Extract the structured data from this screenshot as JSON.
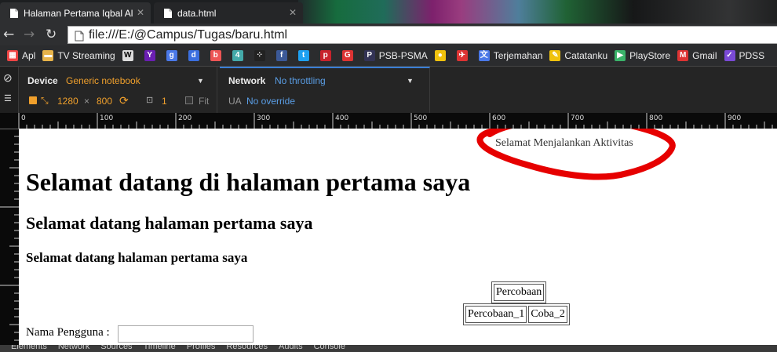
{
  "browser": {
    "tabs": [
      {
        "title": "Halaman Pertama Iqbal Al",
        "active": true
      },
      {
        "title": "data.html",
        "active": false
      }
    ],
    "address": "file:///E:/@Campus/Tugas/baru.html"
  },
  "bookmarks": [
    {
      "label": "Apl",
      "icon": "apps-grid-icon",
      "color": "#e44"
    },
    {
      "label": "TV Streaming",
      "icon": "folder-icon",
      "color": "#e8b44a"
    },
    {
      "label": "",
      "icon": "wikipedia-icon",
      "color": "#ddd"
    },
    {
      "label": "",
      "icon": "yahoo-icon",
      "color": "#6a1fb2"
    },
    {
      "label": "",
      "icon": "google-icon",
      "color": "#4a78e8"
    },
    {
      "label": "",
      "icon": "dailymotion-icon",
      "color": "#3b6fe0"
    },
    {
      "label": "",
      "icon": "blogger-icon",
      "color": "#e55"
    },
    {
      "label": "",
      "icon": "four-icon",
      "color": "#4aa"
    },
    {
      "label": "",
      "icon": "blackberry-icon",
      "color": "#222"
    },
    {
      "label": "",
      "icon": "facebook-icon",
      "color": "#3b5998"
    },
    {
      "label": "",
      "icon": "twitter-icon",
      "color": "#1da1f2"
    },
    {
      "label": "",
      "icon": "pinterest-icon",
      "color": "#c8232c"
    },
    {
      "label": "",
      "icon": "g-red-icon",
      "color": "#d33"
    },
    {
      "label": "PSB-PSMA",
      "icon": "psb-icon",
      "color": "#335"
    },
    {
      "label": "",
      "icon": "chat-icon",
      "color": "#f0c20d"
    },
    {
      "label": "",
      "icon": "bird-icon",
      "color": "#d33"
    },
    {
      "label": "Terjemahan",
      "icon": "translate-icon",
      "color": "#4a78e8"
    },
    {
      "label": "Catatanku",
      "icon": "notes-icon",
      "color": "#f0c20d"
    },
    {
      "label": "PlayStore",
      "icon": "playstore-icon",
      "color": "#3bb36a"
    },
    {
      "label": "Gmail",
      "icon": "gmail-icon",
      "color": "#d33"
    },
    {
      "label": "PDSS",
      "icon": "pdss-icon",
      "color": "#7a4ad6"
    }
  ],
  "device_toolbar": {
    "device_label": "Device",
    "device_value": "Generic notebook",
    "width": "1280",
    "times": "×",
    "height": "800",
    "scale": "1",
    "fit_label": "Fit",
    "network_label": "Network",
    "network_value": "No throttling",
    "ua_label": "UA",
    "ua_value": "No override"
  },
  "ruler": {
    "labels": [
      "0",
      "100",
      "200",
      "300",
      "400",
      "500",
      "600",
      "700",
      "800",
      "900"
    ]
  },
  "page": {
    "activity_text": "Selamat Menjalankan Aktivitas",
    "h1": "Selamat datang di halaman pertama saya",
    "h2": "Selamat datang halaman pertama saya",
    "h3": "Selamat datang halaman pertama saya",
    "table1_cell": "Percobaan",
    "table2_cells": [
      "Percobaan_1",
      "Coba_2"
    ],
    "username_label": "Nama Pengguna :",
    "annotation_color": "#e60000"
  },
  "devtools_tabs": [
    "Elements",
    "Network",
    "Sources",
    "Timeline",
    "Profiles",
    "Resources",
    "Audits",
    "Console"
  ]
}
